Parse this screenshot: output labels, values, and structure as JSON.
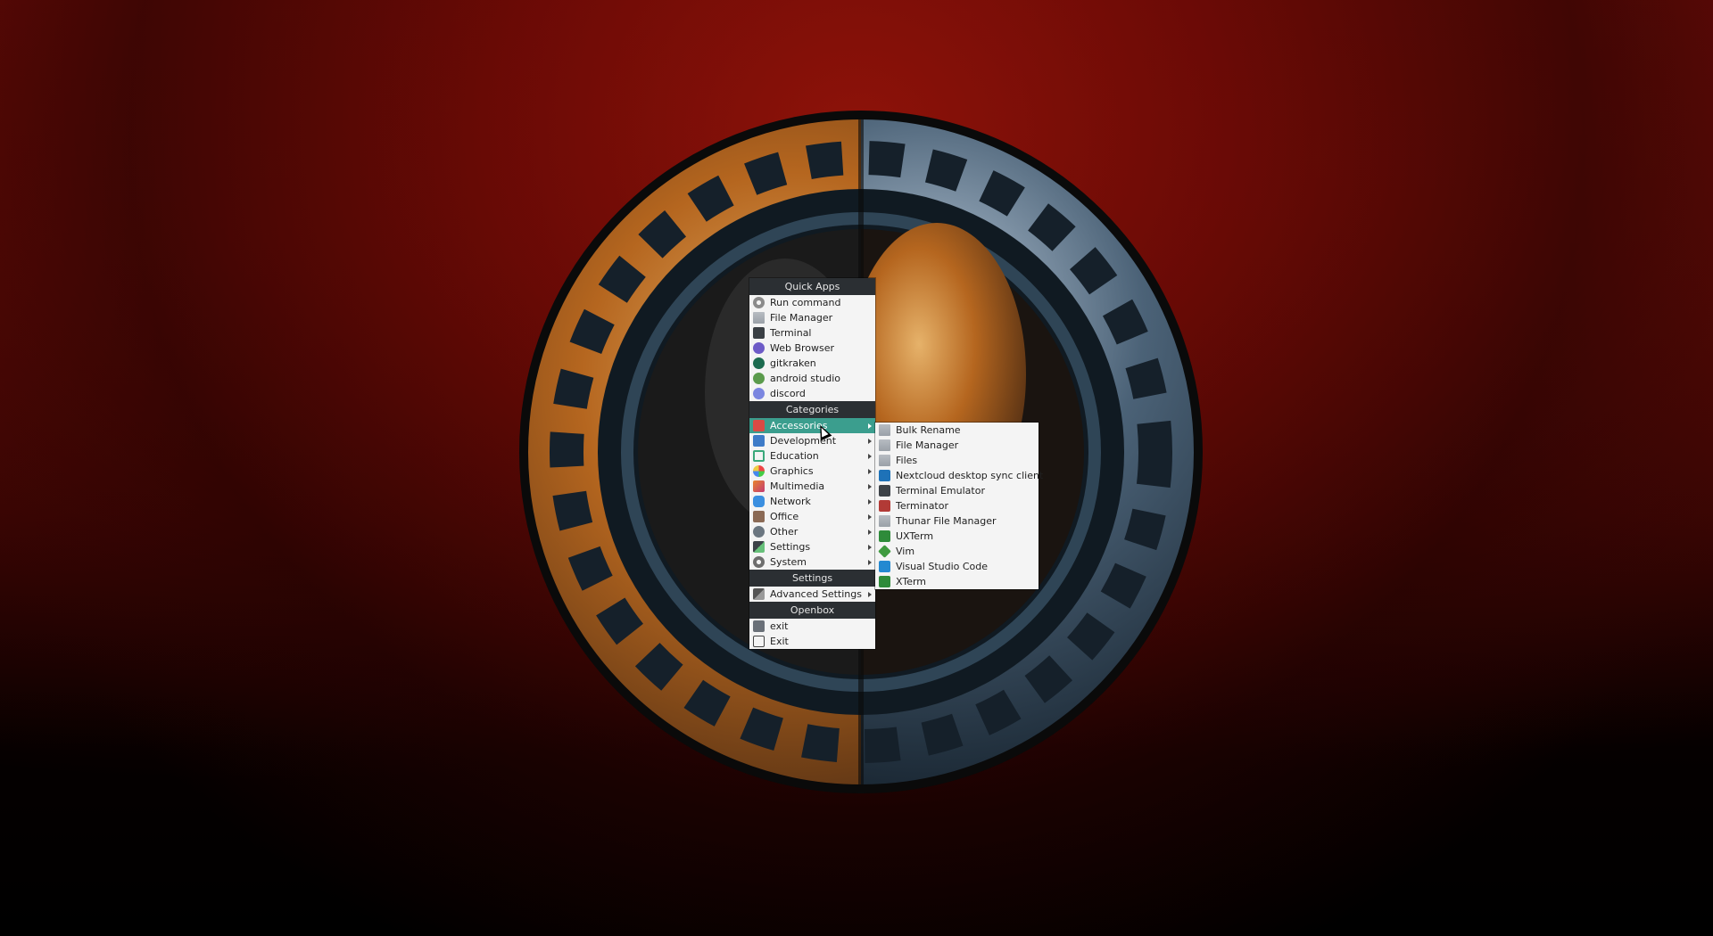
{
  "main_menu": {
    "sections": [
      {
        "header": "Quick Apps",
        "items": [
          {
            "label": "Run command",
            "icon": "gear-icon"
          },
          {
            "label": "File Manager",
            "icon": "folder-icon"
          },
          {
            "label": "Terminal",
            "icon": "terminal-icon"
          },
          {
            "label": "Web Browser",
            "icon": "web-browser-icon"
          },
          {
            "label": "gitkraken",
            "icon": "gitkraken-icon"
          },
          {
            "label": "android studio",
            "icon": "android-studio-icon"
          },
          {
            "label": "discord",
            "icon": "discord-icon"
          }
        ]
      },
      {
        "header": "Categories",
        "items": [
          {
            "label": "Accessories",
            "icon": "accessories-icon",
            "active": true
          },
          {
            "label": "Development",
            "icon": "development-icon"
          },
          {
            "label": "Education",
            "icon": "education-icon"
          },
          {
            "label": "Graphics",
            "icon": "graphics-icon"
          },
          {
            "label": "Multimedia",
            "icon": "multimedia-icon"
          },
          {
            "label": "Network",
            "icon": "network-icon"
          },
          {
            "label": "Office",
            "icon": "office-icon"
          },
          {
            "label": "Other",
            "icon": "other-icon"
          },
          {
            "label": "Settings",
            "icon": "settings-icon"
          },
          {
            "label": "System",
            "icon": "system-icon"
          }
        ]
      },
      {
        "header": "Settings",
        "items": [
          {
            "label": "Advanced Settings",
            "icon": "advanced-settings-icon"
          }
        ]
      },
      {
        "header": "Openbox",
        "items": [
          {
            "label": "exit",
            "icon": "exit-icon"
          },
          {
            "label": "Exit",
            "icon": "logout-icon"
          }
        ]
      }
    ]
  },
  "submenu": {
    "items": [
      {
        "label": "Bulk Rename",
        "icon": "folder-icon"
      },
      {
        "label": "File Manager",
        "icon": "folder-icon"
      },
      {
        "label": "Files",
        "icon": "folder-icon"
      },
      {
        "label": "Nextcloud desktop sync client",
        "icon": "nextcloud-icon"
      },
      {
        "label": "Terminal Emulator",
        "icon": "terminal-icon"
      },
      {
        "label": "Terminator",
        "icon": "terminator-icon"
      },
      {
        "label": "Thunar File Manager",
        "icon": "folder-icon"
      },
      {
        "label": "UXTerm",
        "icon": "uxterm-icon"
      },
      {
        "label": "Vim",
        "icon": "vim-icon"
      },
      {
        "label": "Visual Studio Code",
        "icon": "vscode-icon"
      },
      {
        "label": "XTerm",
        "icon": "xterm-icon"
      }
    ]
  },
  "colors": {
    "menu_header_bg": "#2b2f33",
    "menu_bg": "#f4f4f4",
    "active_item_bg": "#3b9e8e"
  }
}
